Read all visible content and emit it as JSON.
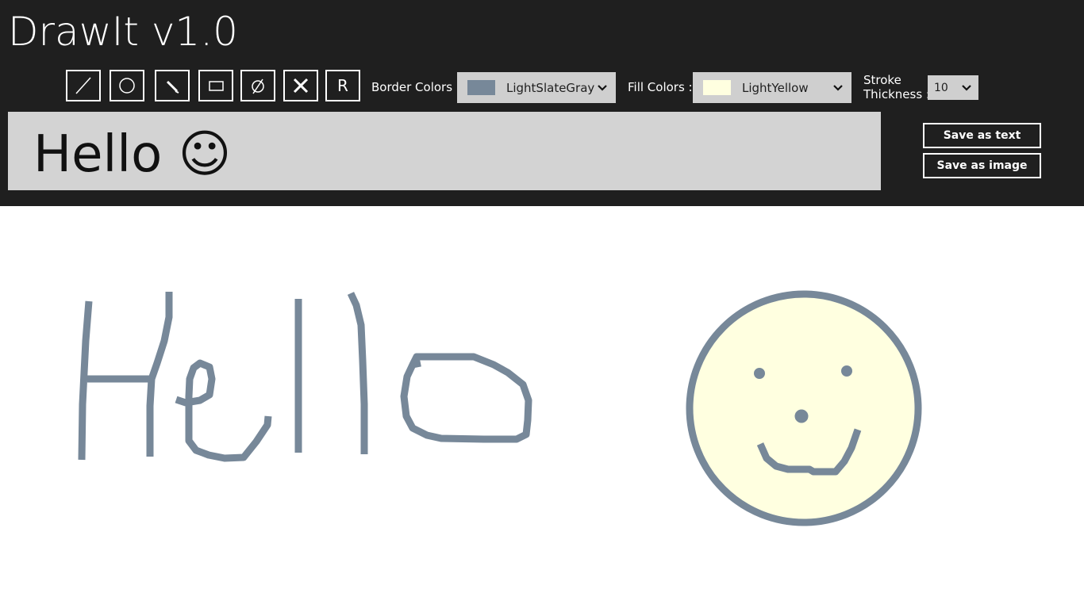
{
  "app": {
    "title": "DrawIt v1.0"
  },
  "tools": [
    {
      "name": "line-tool",
      "icon": "line-icon"
    },
    {
      "name": "ellipse-tool",
      "icon": "circle-icon"
    },
    {
      "name": "pencil-tool",
      "icon": "pencil-icon"
    },
    {
      "name": "rectangle-tool",
      "icon": "rectangle-icon"
    },
    {
      "name": "clear-tool",
      "icon": "empty-set-icon"
    },
    {
      "name": "delete-tool",
      "icon": "close-icon"
    },
    {
      "name": "r-tool",
      "label": "R"
    }
  ],
  "border_colors": {
    "label": "Border Colors :",
    "value": "LightSlateGray",
    "swatch": "#778899"
  },
  "fill_colors": {
    "label": "Fill Colors :",
    "value": "LightYellow",
    "swatch": "#FFFFE0"
  },
  "stroke": {
    "label_line1": "Stroke",
    "label_line2": "Thickness :",
    "value": "10"
  },
  "text_output": {
    "text": "Hello ☺"
  },
  "actions": {
    "save_text": "Save as text",
    "save_image": "Save as image"
  },
  "colors": {
    "header_bg": "#1f1f1f",
    "stroke": "#778899",
    "fill": "#FFFFE0"
  }
}
